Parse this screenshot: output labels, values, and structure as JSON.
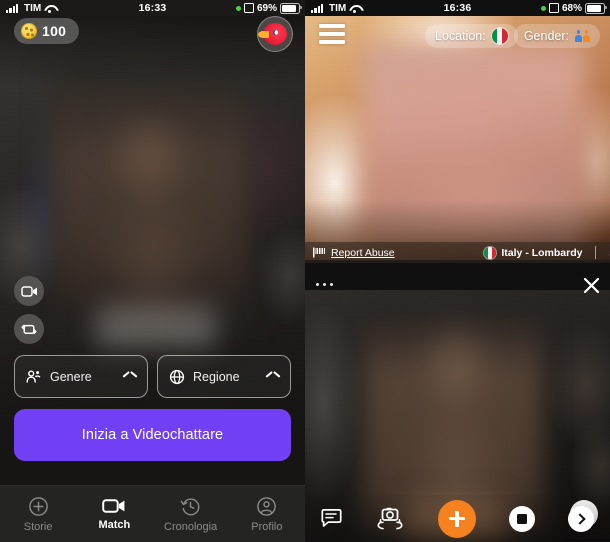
{
  "left_panel": {
    "status_bar": {
      "carrier": "TIM",
      "time": "16:33",
      "battery_percent": "69%",
      "signal_icon": "signal-bars-icon",
      "wifi_icon": "wifi-icon",
      "recording_dot_icon": "green-dot-icon",
      "alarm_icon": "alarm-icon",
      "battery_icon": "battery-icon"
    },
    "coins": {
      "value": "100",
      "icon": "coin-icon"
    },
    "avatar": {
      "icon": "bird-avatar-icon"
    },
    "video_controls": [
      {
        "icon": "video-camera-icon",
        "name": "toggle-camera-button"
      },
      {
        "icon": "camera-flip-icon",
        "name": "switch-camera-button"
      }
    ],
    "filters": [
      {
        "label": "Genere",
        "icon": "people-icon",
        "chevron": "chevron-up-icon"
      },
      {
        "label": "Regione",
        "icon": "globe-icon",
        "chevron": "chevron-up-icon"
      }
    ],
    "cta": {
      "label": "Inizia a Videochattare",
      "color": "#7140f5"
    },
    "tabs": [
      {
        "label": "Storie",
        "icon": "plus-circle-icon",
        "active": false
      },
      {
        "label": "Match",
        "icon": "video-camera-icon",
        "active": true
      },
      {
        "label": "Cronologia",
        "icon": "history-clock-icon",
        "active": false
      },
      {
        "label": "Profilo",
        "icon": "person-circle-icon",
        "active": false
      }
    ]
  },
  "right_panel": {
    "status_bar": {
      "carrier": "TIM",
      "time": "16:36",
      "battery_percent": "68%",
      "signal_icon": "signal-bars-icon",
      "wifi_icon": "wifi-icon",
      "recording_dot_icon": "green-dot-icon",
      "alarm_icon": "alarm-icon",
      "battery_icon": "battery-icon"
    },
    "menu_icon": "hamburger-menu-icon",
    "location_pill": {
      "label": "Location:",
      "flag": "italy-flag-icon"
    },
    "gender_pill": {
      "label": "Gender:",
      "icons": [
        "male-person-icon",
        "female-person-icon"
      ]
    },
    "lock_badge": {
      "icon": "lock-icon"
    },
    "report_bar": {
      "label": "Report Abuse",
      "flag_icon": "report-flag-icon",
      "region": "Italy - Lombardy",
      "region_flag": "italy-flag-icon",
      "gender_symbol": "♂"
    },
    "more_options_icon": "more-dots-icon",
    "close_icon": "close-x-icon",
    "bottom_bar": [
      {
        "name": "chat-button",
        "icon": "chat-bubble-icon"
      },
      {
        "name": "switch-camera-button",
        "icon": "camera-flip-icon"
      },
      {
        "name": "add-button",
        "icon": "plus-icon",
        "color": "#f5821f"
      },
      {
        "name": "stop-button",
        "icon": "stop-square-icon"
      },
      {
        "name": "next-button",
        "icon": "chevron-right-circle-icon"
      }
    ]
  }
}
